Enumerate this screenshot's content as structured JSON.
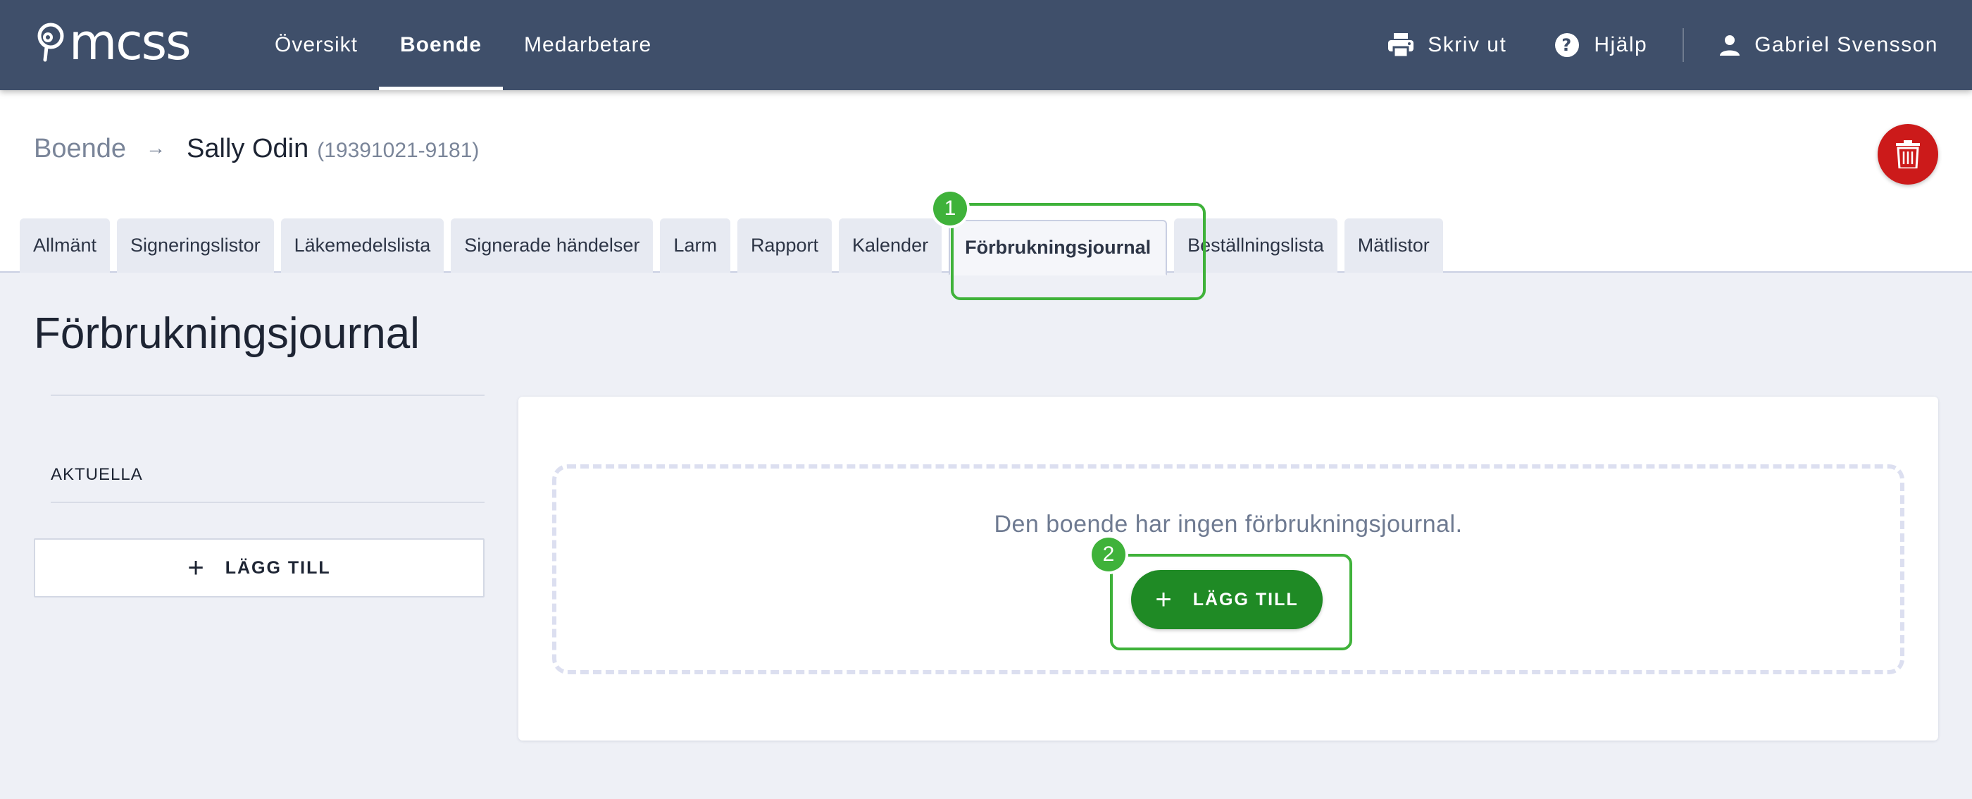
{
  "app": {
    "logo_text": "mcss",
    "nav": [
      {
        "label": "Översikt",
        "active": false
      },
      {
        "label": "Boende",
        "active": true
      },
      {
        "label": "Medarbetare",
        "active": false
      }
    ],
    "actions": {
      "print_label": "Skriv ut",
      "help_label": "Hjälp",
      "user_name": "Gabriel Svensson"
    }
  },
  "breadcrumb": {
    "parent": "Boende",
    "current": "Sally Odin",
    "person_id": "(19391021-9181)"
  },
  "tabs": [
    {
      "label": "Allmänt",
      "active": false
    },
    {
      "label": "Signeringslistor",
      "active": false
    },
    {
      "label": "Läkemedelslista",
      "active": false
    },
    {
      "label": "Signerade händelser",
      "active": false
    },
    {
      "label": "Larm",
      "active": false
    },
    {
      "label": "Rapport",
      "active": false
    },
    {
      "label": "Kalender",
      "active": false
    },
    {
      "label": "Förbrukningsjournal",
      "active": true
    },
    {
      "label": "Beställningslista",
      "active": false
    },
    {
      "label": "Mätlistor",
      "active": false
    }
  ],
  "page": {
    "title": "Förbrukningsjournal",
    "section_label": "AKTUELLA",
    "add_button_label": "LÄGG TILL",
    "empty_message": "Den boende har ingen förbrukningsjournal.",
    "empty_add_button_label": "LÄGG TILL"
  },
  "steps": [
    {
      "number": "1",
      "target": "tab-forbrukningsjournal"
    },
    {
      "number": "2",
      "target": "empty-add-button"
    }
  ],
  "colors": {
    "topbar": "#3f4f6a",
    "primary_green": "#1f8a25",
    "highlight_green": "#3fb23a",
    "delete_red": "#cc1a1a"
  }
}
